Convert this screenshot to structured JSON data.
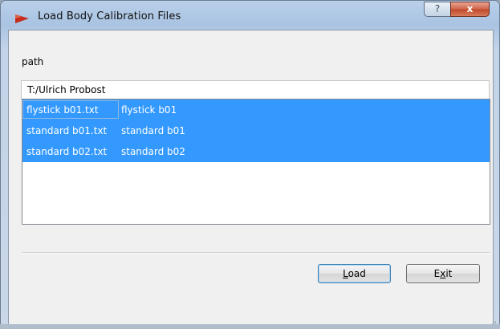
{
  "window": {
    "title": "Load Body Calibration Files",
    "help_glyph": "?",
    "close_glyph": "x"
  },
  "path": {
    "label": "path",
    "value": "T:/Ulrich Probost"
  },
  "files": [
    {
      "filename": "flystick b01.txt",
      "name": "flystick b01",
      "selected": true
    },
    {
      "filename": "standard b01.txt",
      "name": "standard b01",
      "selected": true
    },
    {
      "filename": "standard b02.txt",
      "name": "standard b02",
      "selected": true
    }
  ],
  "buttons": {
    "load_label": "Load",
    "exit_label": "Exit"
  },
  "colors": {
    "selection": "#3399ff",
    "title_icon": "#c0392b",
    "close_button": "#c24a2c"
  }
}
